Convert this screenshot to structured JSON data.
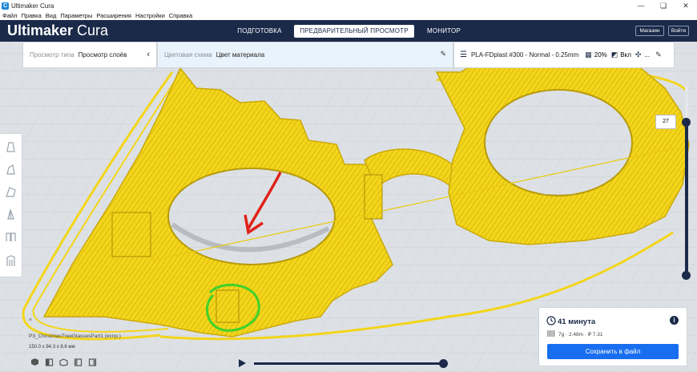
{
  "window": {
    "title": "Ultimaker Cura",
    "controls": [
      "—",
      "❏",
      "✕"
    ]
  },
  "menu": [
    "Файл",
    "Правка",
    "Вид",
    "Параметры",
    "Расширения",
    "Настройки",
    "Справка"
  ],
  "header": {
    "brand_bold": "Ultimaker",
    "brand_light": " Cura",
    "tabs": [
      {
        "label": "ПОДГОТОВКА",
        "active": false
      },
      {
        "label": "ПРЕДВАРИТЕЛЬНЫЙ ПРОСМОТР",
        "active": true
      },
      {
        "label": "МОНИТОР",
        "active": false
      }
    ],
    "marketplace": "Магазин",
    "signin": "Войти"
  },
  "toolbar": {
    "view_type_label": "Просмотр типа",
    "view_type_value": "Просмотр слоёв",
    "color_scheme_label": "Цветовая схема",
    "color_scheme_value": "Цвет материала",
    "profile": "PLA-FDplast #300 - Normal - 0.25mm",
    "infill": "20%",
    "support": "Вкл",
    "more": "..."
  },
  "layer_slider": {
    "current": "27"
  },
  "object": {
    "name": "P3_ChristmasTreeGlassesPart1 (испр.)",
    "dims": "150.0 x 94.3 x 8.6 мм"
  },
  "print_info": {
    "time": "41 минута",
    "material": "7g · 2.48m · ₽ 7.31",
    "save": "Сохранить в файл"
  },
  "colors": {
    "header": "#1b2a49",
    "model_yellow": "#f3d51a",
    "accent_blue": "#196ef0",
    "annotation_red": "#e0221a",
    "annotation_green": "#3fd22a"
  }
}
